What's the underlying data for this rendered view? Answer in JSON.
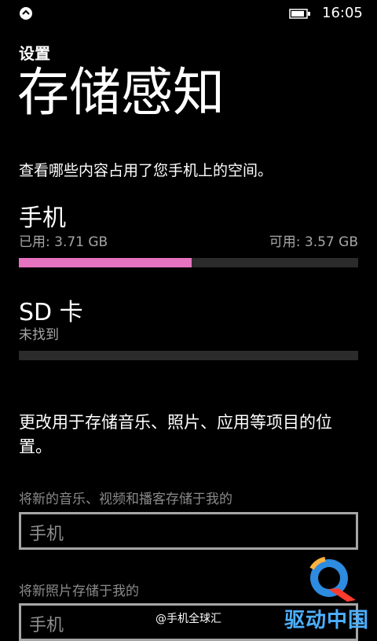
{
  "status": {
    "time": "16:05",
    "left_icon": "phone-sync-icon",
    "battery_icon": "battery-icon"
  },
  "header": {
    "subtitle": "设置",
    "title": "存储感知"
  },
  "description": "查看哪些内容占用了您手机上的空间。",
  "phone": {
    "title": "手机",
    "used_label": "已用: 3.71 GB",
    "available_label": "可用: 3.57 GB",
    "usage_fraction": 0.51,
    "fill_color": "#e673c0"
  },
  "sd": {
    "title": "SD 卡",
    "status": "未找到",
    "usage_fraction": 0
  },
  "change_location_text": "更改用于存储音乐、照片、应用等项目的位置。",
  "music_setting": {
    "label": "将新的音乐、视频和播客存储于我的",
    "value": "手机"
  },
  "photo_setting": {
    "label": "将新照片存储于我的",
    "value": "手机"
  },
  "watermark": {
    "text": "@手机全球汇",
    "logo_text": "驱动中国",
    "logo_icon": "drive-china-logo-icon"
  }
}
